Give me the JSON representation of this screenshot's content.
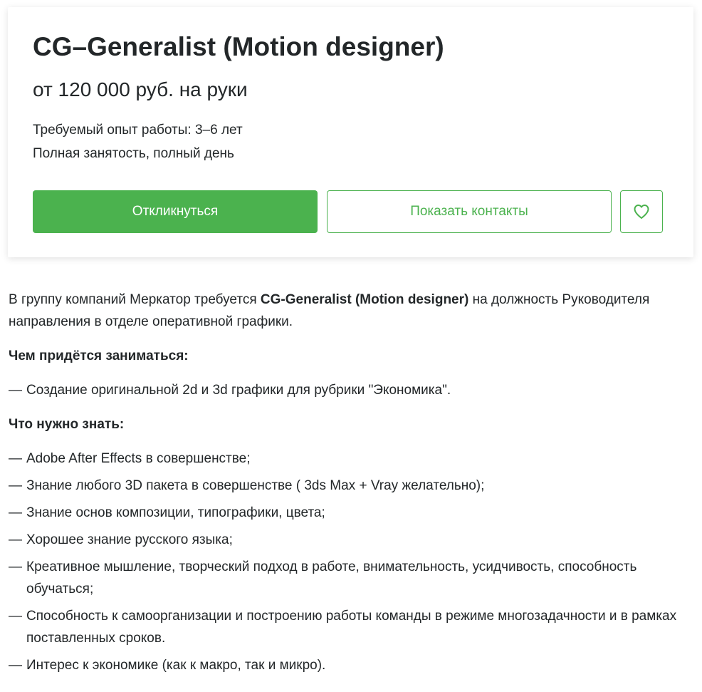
{
  "vacancy": {
    "title": "CG–Generalist (Motion designer)",
    "salary": "от 120 000 руб. на руки",
    "experience": "Требуемый опыт работы: 3–6 лет",
    "employment": "Полная занятость, полный день",
    "respond_label": "Откликнуться",
    "contacts_label": "Показать контакты",
    "favorite_icon": "heart-icon"
  },
  "colors": {
    "accent": "#4bb24e",
    "text": "#232729"
  },
  "description": {
    "intro_before": "В группу компаний Меркатор требуется ",
    "intro_bold": "CG-Generalist (Motion designer)",
    "intro_after": " на должность Руководителя направления в отделе оперативной графики.",
    "duties_heading": "Чем придётся заниматься:",
    "duties": [
      "Создание оригинальной 2d и 3d графики для рубрики \"Экономика\"."
    ],
    "skills_heading": "Что нужно знать:",
    "skills": [
      "Adobe After Effects в совершенстве;",
      "Знание любого 3D пакета в совершенстве ( 3ds Max + Vray желательно);",
      "Знание основ композиции, типографики, цвета;",
      "Хорошее знание русского языка;",
      "Креативное мышление, творческий подход в работе, внимательность, усидчивость, способность обучаться;",
      "Способность к самоорганизации и построению работы команды в режиме многозадачности и в рамках поставленных сроков.",
      "Интерес к экономике (как к макро, так и микро)."
    ],
    "bullet": "—"
  }
}
